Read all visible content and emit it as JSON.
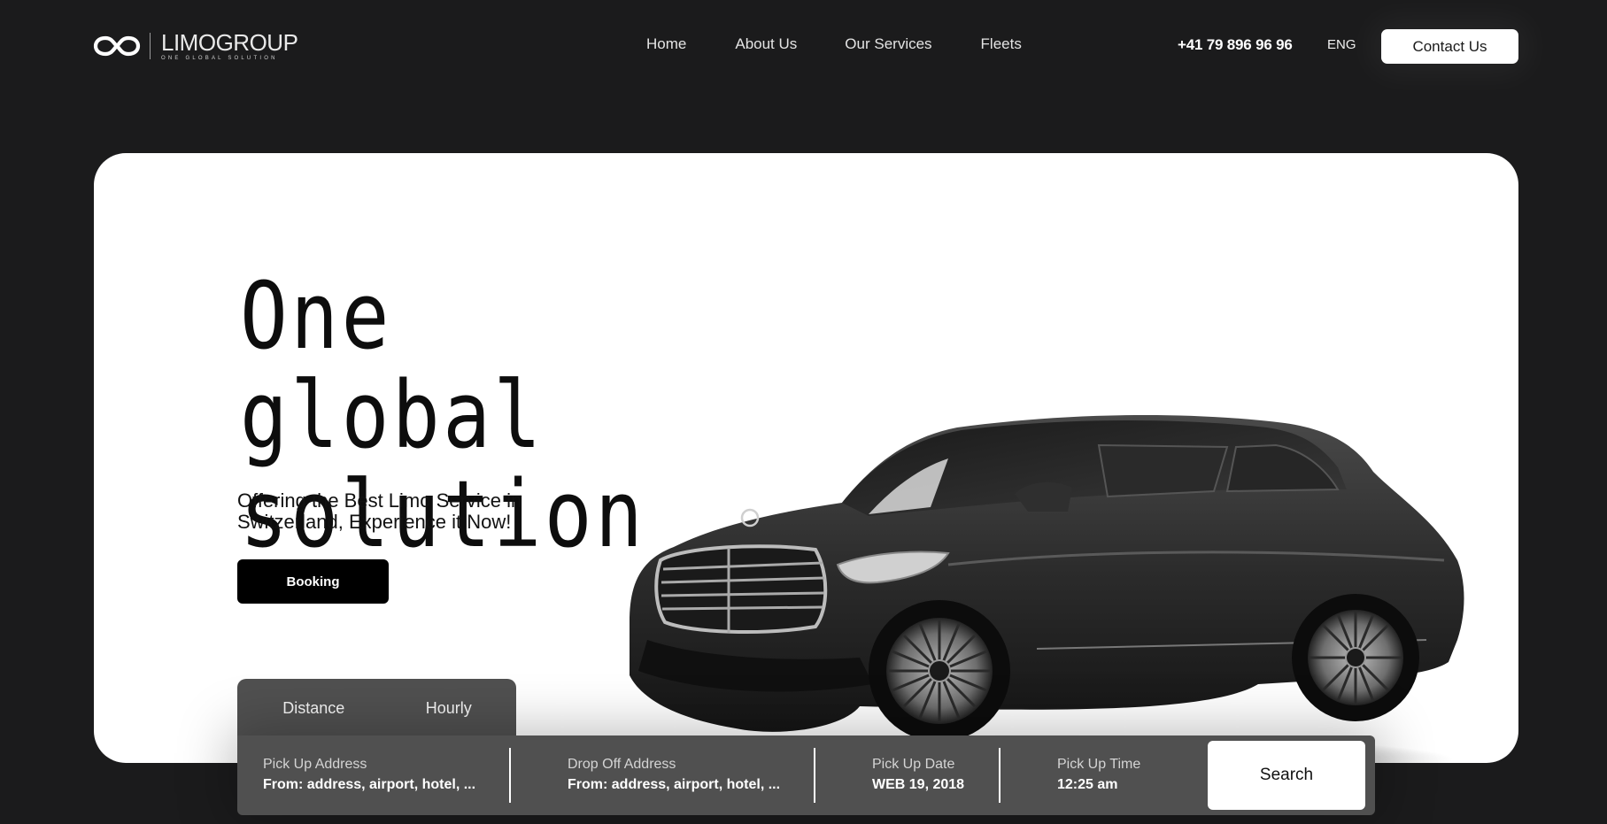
{
  "brand": {
    "name": "LIMOGROUP",
    "tagline": "ONE GLOBAL SOLUTION",
    "logo_icon": "infinity-icon"
  },
  "nav": {
    "items": [
      {
        "label": "Home"
      },
      {
        "label": "About Us"
      },
      {
        "label": "Our Services"
      },
      {
        "label": "Fleets"
      }
    ]
  },
  "header": {
    "phone": "+41 79 896 96 96",
    "language": "ENG",
    "contact_label": "Contact Us"
  },
  "hero": {
    "title_line1": "One global",
    "title_line2": "solution",
    "subtitle_line1": "Offering the Best Limo Service in",
    "subtitle_line2": "Switzerland, Experience it Now!",
    "booking_label": "Booking",
    "image": "black-sedan-car"
  },
  "search": {
    "tabs": [
      {
        "label": "Distance"
      },
      {
        "label": "Hourly"
      }
    ],
    "pickup_address": {
      "label": "Pick Up Address",
      "value": "From: address, airport, hotel, ..."
    },
    "dropoff_address": {
      "label": "Drop Off Address",
      "value": "From: address, airport, hotel, ..."
    },
    "pickup_date": {
      "label": "Pick Up Date",
      "value": "WEB 19, 2018"
    },
    "pickup_time": {
      "label": "Pick Up Time",
      "value": "12:25 am"
    },
    "search_label": "Search"
  },
  "colors": {
    "background": "#1b1b1c",
    "card": "#ffffff",
    "panel": "#505050",
    "accent": "#000000"
  }
}
